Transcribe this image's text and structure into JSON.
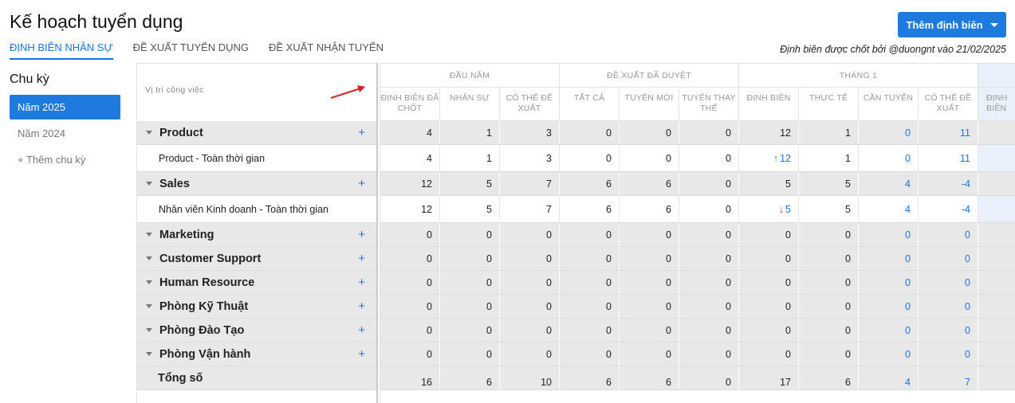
{
  "page": {
    "title": "Kế hoạch tuyển dụng",
    "add_button": "Thêm định biên",
    "finalized_note": "Định biên được chốt bởi @duongnt vào 21/02/2025"
  },
  "tabs": [
    {
      "label": "Định biên nhân sự",
      "active": true
    },
    {
      "label": "Đề xuất tuyển dụng",
      "active": false
    },
    {
      "label": "Đề xuất nhận tuyển",
      "active": false
    }
  ],
  "sidebar": {
    "title": "Chu kỳ",
    "cycles": [
      {
        "label": "Năm 2025",
        "active": true
      },
      {
        "label": "Năm 2024",
        "active": false
      },
      {
        "label": "+ Thêm chu kỳ",
        "active": false
      }
    ]
  },
  "table": {
    "position_header": "Vị trí công việc",
    "groups": [
      {
        "label": "Đầu năm",
        "columns": [
          "Định biên đã chốt",
          "Nhân sự",
          "Có thể đề xuất"
        ]
      },
      {
        "label": "Đề xuất đã duyệt",
        "columns": [
          "Tất cả",
          "Tuyển mới",
          "Tuyển thay thế"
        ]
      },
      {
        "label": "Tháng 1",
        "columns": [
          "Định biên",
          "Thực tế",
          "Cần tuyển",
          "Có thể đề xuất"
        ]
      }
    ],
    "partial_column": "Định biên",
    "rows": [
      {
        "type": "group",
        "name": "Product",
        "values": [
          "4",
          "1",
          "3",
          "0",
          "0",
          "0",
          "12",
          "1",
          "0",
          "11"
        ]
      },
      {
        "type": "detail",
        "name": "Product - Toàn thời gian",
        "values": [
          "4",
          "1",
          "3",
          "0",
          "0",
          "0",
          "12",
          "1",
          "0",
          "11"
        ],
        "trend": "up"
      },
      {
        "type": "group",
        "name": "Sales",
        "values": [
          "12",
          "5",
          "7",
          "6",
          "6",
          "0",
          "5",
          "5",
          "4",
          "-4"
        ]
      },
      {
        "type": "detail",
        "name": "Nhân viên Kinh doanh - Toàn thời gian",
        "values": [
          "12",
          "5",
          "7",
          "6",
          "6",
          "0",
          "5",
          "5",
          "4",
          "-4"
        ],
        "trend": "down"
      },
      {
        "type": "group",
        "name": "Marketing",
        "values": [
          "0",
          "0",
          "0",
          "0",
          "0",
          "0",
          "0",
          "0",
          "0",
          "0"
        ]
      },
      {
        "type": "group",
        "name": "Customer Support",
        "values": [
          "0",
          "0",
          "0",
          "0",
          "0",
          "0",
          "0",
          "0",
          "0",
          "0"
        ]
      },
      {
        "type": "group",
        "name": "Human Resource",
        "values": [
          "0",
          "0",
          "0",
          "0",
          "0",
          "0",
          "0",
          "0",
          "0",
          "0"
        ]
      },
      {
        "type": "group",
        "name": "Phòng Kỹ Thuật",
        "values": [
          "0",
          "0",
          "0",
          "0",
          "0",
          "0",
          "0",
          "0",
          "0",
          "0"
        ]
      },
      {
        "type": "group",
        "name": "Phòng Đào Tạo",
        "values": [
          "0",
          "0",
          "0",
          "0",
          "0",
          "0",
          "0",
          "0",
          "0",
          "0"
        ]
      },
      {
        "type": "group",
        "name": "Phòng Vận hành",
        "values": [
          "0",
          "0",
          "0",
          "0",
          "0",
          "0",
          "0",
          "0",
          "0",
          "0"
        ]
      },
      {
        "type": "total",
        "name": "Tổng số",
        "values": [
          "16",
          "6",
          "10",
          "6",
          "6",
          "0",
          "17",
          "6",
          "4",
          "7"
        ]
      }
    ]
  },
  "colors": {
    "accent": "#1f7ae0",
    "trend_up": "#2e9e3e",
    "trend_down": "#dd3333",
    "annotation_arrow": "#e02020"
  }
}
